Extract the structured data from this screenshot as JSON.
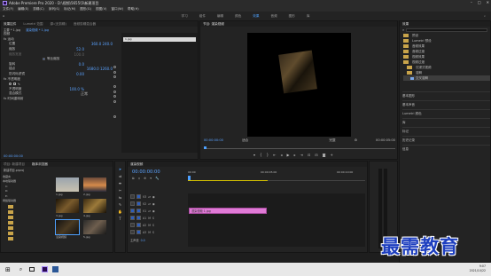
{
  "titlebar": {
    "title": "Adobe Premiere Pro 2020 - D:\\视频\\5655\\5\\新建项目"
  },
  "menu": [
    "文件(F)",
    "编辑(E)",
    "剪辑(C)",
    "序列(S)",
    "标记(M)",
    "图形(G)",
    "视图(V)",
    "窗口(W)",
    "帮助(H)"
  ],
  "workspaces": [
    "学习",
    "组件",
    "编辑",
    "颜色",
    "效果",
    "音频",
    "图形",
    "库"
  ],
  "active_workspace": "效果",
  "effect_controls": {
    "tabs": [
      "效果控件",
      "Lumetri 范围",
      "源:(无剪辑)",
      "音频剪辑混合器"
    ],
    "source_label": "主要 * 1.jpg",
    "clip_label": "渲染视频 * 1.jpg",
    "mini_clip": "1.jpg",
    "rows": [
      {
        "label": "视频",
        "value": ""
      },
      {
        "label": "fx 运动",
        "value": ""
      },
      {
        "label": "位置",
        "value": "360.0  240.0"
      },
      {
        "label": "缩放",
        "value": "52.0"
      },
      {
        "label": "缩放宽度",
        "value": "100.0"
      },
      {
        "label": "",
        "value": "等比缩放"
      },
      {
        "label": "旋转",
        "value": "0.0"
      },
      {
        "label": "锚点",
        "value": "1680.0  1260.0"
      },
      {
        "label": "防闪烁滤镜",
        "value": "0.00"
      },
      {
        "label": "fx 不透明度",
        "value": ""
      },
      {
        "label": "",
        "value": ""
      },
      {
        "label": "不透明度",
        "value": "100.0 %"
      },
      {
        "label": "混合模式",
        "value": "正常"
      },
      {
        "label": "fx 时间重映射",
        "value": ""
      }
    ],
    "timecode": "00:00:00:00"
  },
  "program": {
    "tab": "节目: 渲染视频",
    "timecode_left": "00:00:00:00",
    "fit": "适合",
    "quality": "完整",
    "timecode_right": "00:00:05:00"
  },
  "effects_panel": {
    "tab": "效果",
    "tree": [
      "预设",
      "Lumetri 预设",
      "音频效果",
      "音频过渡",
      "视频效果",
      "视频过渡",
      "沉浸式视频",
      "溶解",
      "交叉溶解"
    ],
    "sections": [
      "基本图形",
      "基本声音",
      "Lumetri 颜色",
      "库",
      "标记",
      "历史记录",
      "信息"
    ]
  },
  "project": {
    "tabs": [
      "项目: 新建项目",
      "媒体浏览器"
    ],
    "path": "新建项目.prproj",
    "items": [
      "1.jpg",
      "2.jpg",
      "3.jpg",
      "4.jpg",
      "渲染视频",
      "5.jpg"
    ],
    "folders": [
      "收藏夹",
      "本地驱动器",
      "C:",
      "D:",
      "E:",
      "网络驱动器"
    ],
    "search_placeholder": ""
  },
  "timeline": {
    "tab": "渲染视频",
    "timecode": "00:00:00:00",
    "ruler": [
      "00:00",
      "00:00:05:00",
      "00:00:10:00"
    ],
    "tracks": [
      "V3",
      "V2",
      "V1",
      "A1",
      "A2",
      "A3"
    ],
    "master": "主声道",
    "master_value": "0.0",
    "clip_label": "渲染视频 1.jpg"
  },
  "taskbar": {
    "time": "9:07",
    "date": "2021/10/22"
  },
  "watermark": "最需教育",
  "colors": {
    "accent": "#4ea1ff",
    "clip": "#e07ad6",
    "taskbar": "#e8e8e8"
  }
}
